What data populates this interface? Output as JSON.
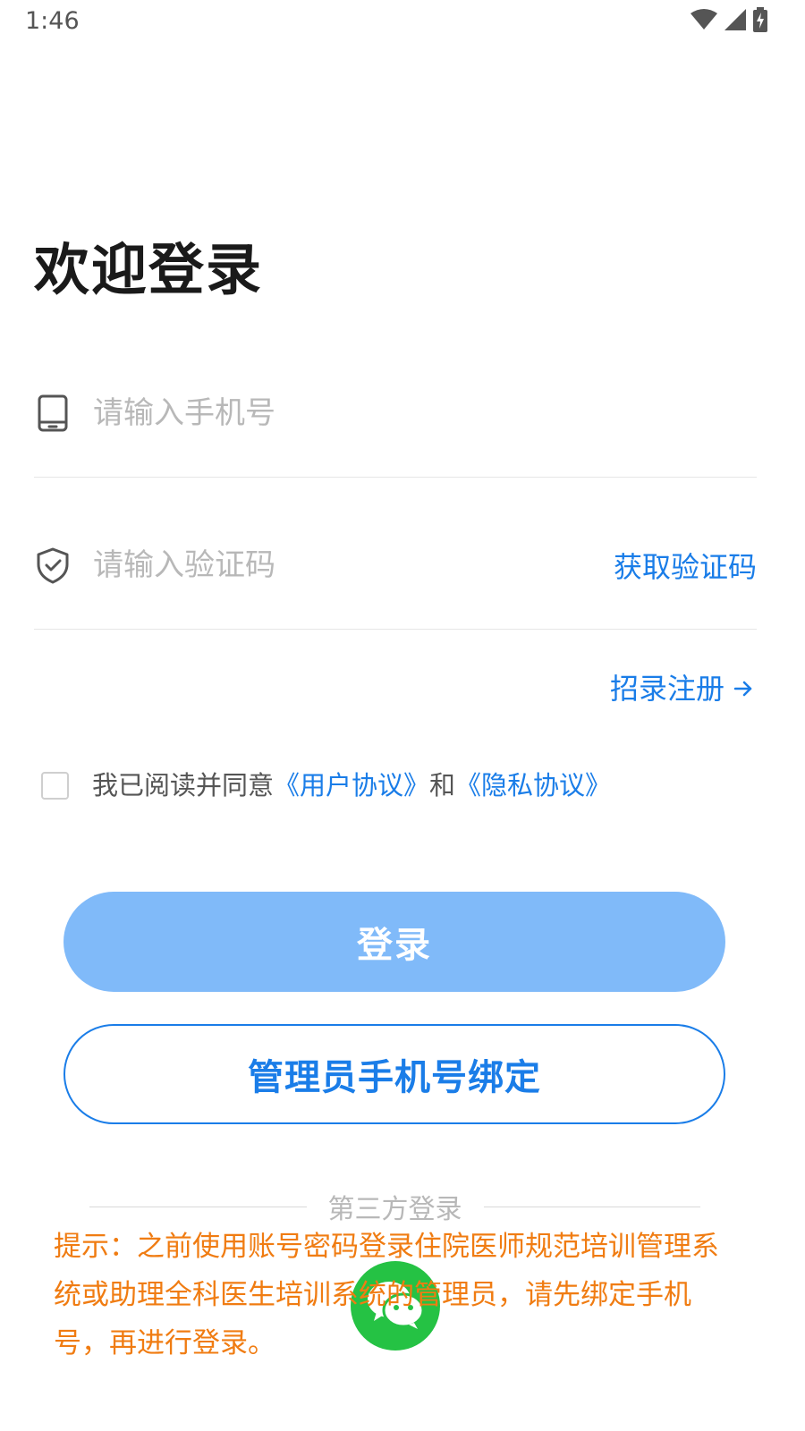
{
  "status_bar": {
    "time": "1:46"
  },
  "title": "欢迎登录",
  "phone_field": {
    "placeholder": "请输入手机号",
    "value": "",
    "icon": "phone-icon"
  },
  "code_field": {
    "placeholder": "请输入验证码",
    "value": "",
    "icon": "shield-check-icon",
    "get_code_label": "获取验证码"
  },
  "register": {
    "label": "招录注册",
    "icon": "arrow-right-icon"
  },
  "agreement": {
    "checked": false,
    "prefix": "我已阅读并同意",
    "user_agreement": "《用户协议》",
    "and": "和",
    "privacy_agreement": "《隐私协议》"
  },
  "buttons": {
    "login_label": "登录",
    "bind_label": "管理员手机号绑定"
  },
  "third_party": {
    "label": "第三方登录",
    "wechat_icon": "wechat-icon"
  },
  "tip": "提示：之前使用账号密码登录住院医师规范培训管理系统或助理全科医生培训系统的管理员，请先绑定手机号，再进行登录。",
  "colors": {
    "accent": "#1a7de8",
    "login_button": "#80baf9",
    "tip": "#f07c12",
    "wechat": "#25c244"
  }
}
